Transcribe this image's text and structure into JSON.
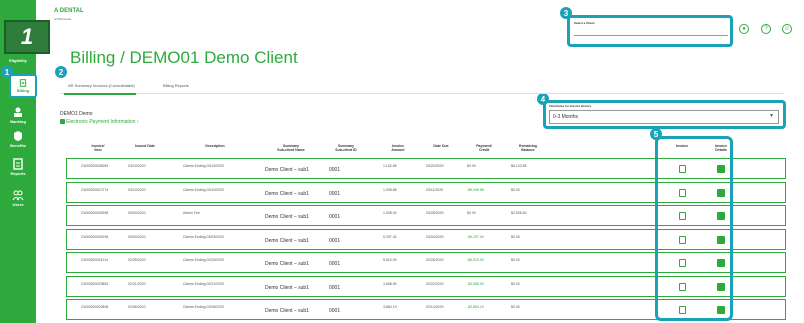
{
  "brand": {
    "name": "A DENTAL",
    "subtitle": "of Minnesota"
  },
  "step_marker": "1",
  "callouts": [
    "1",
    "2",
    "3",
    "4",
    "5"
  ],
  "sidebar": {
    "items": [
      {
        "label": "Eligibility"
      },
      {
        "label": "Billing"
      },
      {
        "label": "Banking"
      },
      {
        "label": "Benefits"
      },
      {
        "label": "Reports"
      },
      {
        "label": "Users"
      }
    ]
  },
  "header": {
    "client_label": "Select a Client",
    "client_value": "",
    "page_title": "Billing / DEMO01 Demo Client"
  },
  "tabs": [
    {
      "label": "AR Summary Invoices (Consolidated)",
      "active": true
    },
    {
      "label": "Billing Reports",
      "active": false
    }
  ],
  "client": {
    "name": "DEMO1 Demo",
    "payment_link": "Electronic Payment Information"
  },
  "timeframe": {
    "label": "Timeframe for Invoice History",
    "value": "0-3 Months"
  },
  "table": {
    "columns": [
      "Invoice/\nItem",
      "Issued Date",
      "Description",
      "Summary\nSub-client Name",
      "Summary\nSub-client ID",
      "Invoice\nAmount",
      "Date Due",
      "Payment/\nCredit",
      "Remaining\nBalance",
      "Invoice",
      "Invoice\nDetails"
    ],
    "rows": [
      {
        "invoice": "CW00000028053",
        "issued": "03/19/2020",
        "desc": "Claims Ending 03/19/2020",
        "sub_name": "Demo Client – sub1",
        "sub_id": "0001",
        "amount": "1,102.85",
        "due": "03/20/2020",
        "payment": "$0.00",
        "balance": "$6,103.85"
      },
      {
        "invoice": "CW00000027274",
        "issued": "03/10/2020",
        "desc": "Claims Ending 03/10/2020",
        "sub_name": "Demo Client – sub1",
        "sub_id": "0001",
        "amount": "1,098.88",
        "due": "03/11/2020",
        "payment": "-$5,098.88",
        "balance": "$0.00"
      },
      {
        "invoice": "CW00000025398",
        "issued": "03/03/2020",
        "desc": "Admin Fee",
        "sub_name": "Demo Client – sub1",
        "sub_id": "0001",
        "amount": "1,908.00",
        "due": "03/28/2020",
        "payment": "$0.00",
        "balance": "$2,505.60"
      },
      {
        "invoice": "CW00000025298",
        "issued": "03/03/2020",
        "desc": "Claims Ending 03/03/2020",
        "sub_name": "Demo Client – sub1",
        "sub_id": "0001",
        "amount": "9,297.04",
        "due": "03/04/2020",
        "payment": "-$9,297.04",
        "balance": "$0.00"
      },
      {
        "invoice": "CW00000024114",
        "issued": "02/25/2020",
        "desc": "Claims Ending 02/25/2020",
        "sub_name": "Demo Client – sub1",
        "sub_id": "0001",
        "amount": "5,510.00",
        "due": "02/26/2020",
        "payment": "-$5,510.00",
        "balance": "$0.00"
      },
      {
        "invoice": "CW00000023853",
        "issued": "02/21/2020",
        "desc": "Claims Ending 02/21/2020",
        "sub_name": "Demo Client – sub1",
        "sub_id": "0001",
        "amount": "3,658.90",
        "due": "02/22/2020",
        "payment": "-$3,658.90",
        "balance": "$0.00"
      },
      {
        "invoice": "CW00000020808",
        "issued": "02/06/2020",
        "desc": "Claims Ending 02/06/2020",
        "sub_name": "Demo Client – sub1",
        "sub_id": "0001",
        "amount": "3,884.19",
        "due": "02/14/2020",
        "payment": "-$3,884.19",
        "balance": "$0.00"
      }
    ]
  },
  "colors": {
    "brand_green": "#2eaa3c",
    "callout_teal": "#1aa3b8"
  }
}
